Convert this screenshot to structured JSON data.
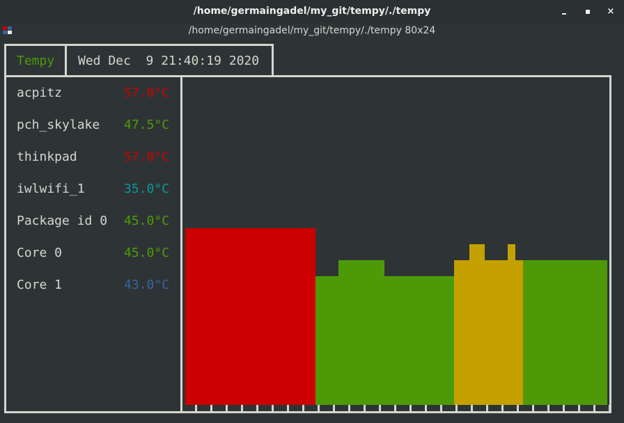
{
  "window": {
    "title": "/home/germaingadel/my_git/tempy/./tempy",
    "subtitle": "/home/germaingadel/my_git/tempy/./tempy 80x24",
    "controls": [
      "minimize",
      "maximize",
      "close"
    ],
    "close_glyph": "×"
  },
  "header": {
    "app_name": "Tempy",
    "datetime": "Wed Dec  9 21:40:19 2020"
  },
  "colors": {
    "background": "#2e3436",
    "border": "#d3d7cf",
    "text": "#d3d7cf",
    "hot": "#cc0000",
    "warm": "#c4a000",
    "ok": "#4e9a06",
    "cool": "#06989a",
    "cold": "#3465a4"
  },
  "sensors": [
    {
      "name": "acpitz",
      "temp": "57.0°C",
      "color": "#cc0000"
    },
    {
      "name": "pch_skylake",
      "temp": "47.5°C",
      "color": "#4e9a06"
    },
    {
      "name": "thinkpad",
      "temp": "57.0°C",
      "color": "#cc0000"
    },
    {
      "name": "iwlwifi_1",
      "temp": "35.0°C",
      "color": "#06989a"
    },
    {
      "name": "Package id 0",
      "temp": "45.0°C",
      "color": "#4e9a06"
    },
    {
      "name": "Core 0",
      "temp": "45.0°C",
      "color": "#4e9a06"
    },
    {
      "name": "Core 1",
      "temp": "43.0°C",
      "color": "#3465a4"
    }
  ],
  "chart_data": {
    "type": "area",
    "samples": [
      {
        "level": 11,
        "color": "#cc0000"
      },
      {
        "level": 11,
        "color": "#cc0000"
      },
      {
        "level": 11,
        "color": "#cc0000"
      },
      {
        "level": 11,
        "color": "#cc0000"
      },
      {
        "level": 11,
        "color": "#cc0000"
      },
      {
        "level": 11,
        "color": "#cc0000"
      },
      {
        "level": 11,
        "color": "#cc0000"
      },
      {
        "level": 11,
        "color": "#cc0000"
      },
      {
        "level": 11,
        "color": "#cc0000"
      },
      {
        "level": 11,
        "color": "#cc0000"
      },
      {
        "level": 11,
        "color": "#cc0000"
      },
      {
        "level": 11,
        "color": "#cc0000"
      },
      {
        "level": 11,
        "color": "#cc0000"
      },
      {
        "level": 11,
        "color": "#cc0000"
      },
      {
        "level": 11,
        "color": "#cc0000"
      },
      {
        "level": 11,
        "color": "#cc0000"
      },
      {
        "level": 11,
        "color": "#cc0000"
      },
      {
        "level": 8,
        "color": "#4e9a06"
      },
      {
        "level": 8,
        "color": "#4e9a06"
      },
      {
        "level": 8,
        "color": "#4e9a06"
      },
      {
        "level": 9,
        "color": "#4e9a06"
      },
      {
        "level": 9,
        "color": "#4e9a06"
      },
      {
        "level": 9,
        "color": "#4e9a06"
      },
      {
        "level": 9,
        "color": "#4e9a06"
      },
      {
        "level": 9,
        "color": "#4e9a06"
      },
      {
        "level": 9,
        "color": "#4e9a06"
      },
      {
        "level": 8,
        "color": "#4e9a06"
      },
      {
        "level": 8,
        "color": "#4e9a06"
      },
      {
        "level": 8,
        "color": "#4e9a06"
      },
      {
        "level": 8,
        "color": "#4e9a06"
      },
      {
        "level": 8,
        "color": "#4e9a06"
      },
      {
        "level": 8,
        "color": "#4e9a06"
      },
      {
        "level": 8,
        "color": "#4e9a06"
      },
      {
        "level": 8,
        "color": "#4e9a06"
      },
      {
        "level": 8,
        "color": "#4e9a06"
      },
      {
        "level": 9,
        "color": "#c4a000"
      },
      {
        "level": 9,
        "color": "#c4a000"
      },
      {
        "level": 10,
        "color": "#c4a000"
      },
      {
        "level": 10,
        "color": "#c4a000"
      },
      {
        "level": 9,
        "color": "#c4a000"
      },
      {
        "level": 9,
        "color": "#c4a000"
      },
      {
        "level": 9,
        "color": "#c4a000"
      },
      {
        "level": 10,
        "color": "#c4a000"
      },
      {
        "level": 9,
        "color": "#c4a000"
      },
      {
        "level": 9,
        "color": "#4e9a06"
      },
      {
        "level": 9,
        "color": "#4e9a06"
      },
      {
        "level": 9,
        "color": "#4e9a06"
      },
      {
        "level": 9,
        "color": "#4e9a06"
      },
      {
        "level": 9,
        "color": "#4e9a06"
      },
      {
        "level": 9,
        "color": "#4e9a06"
      },
      {
        "level": 9,
        "color": "#4e9a06"
      },
      {
        "level": 9,
        "color": "#4e9a06"
      },
      {
        "level": 9,
        "color": "#4e9a06"
      },
      {
        "level": 9,
        "color": "#4e9a06"
      },
      {
        "level": 9,
        "color": "#4e9a06"
      }
    ],
    "max_level": 20,
    "tick_count": 28
  }
}
